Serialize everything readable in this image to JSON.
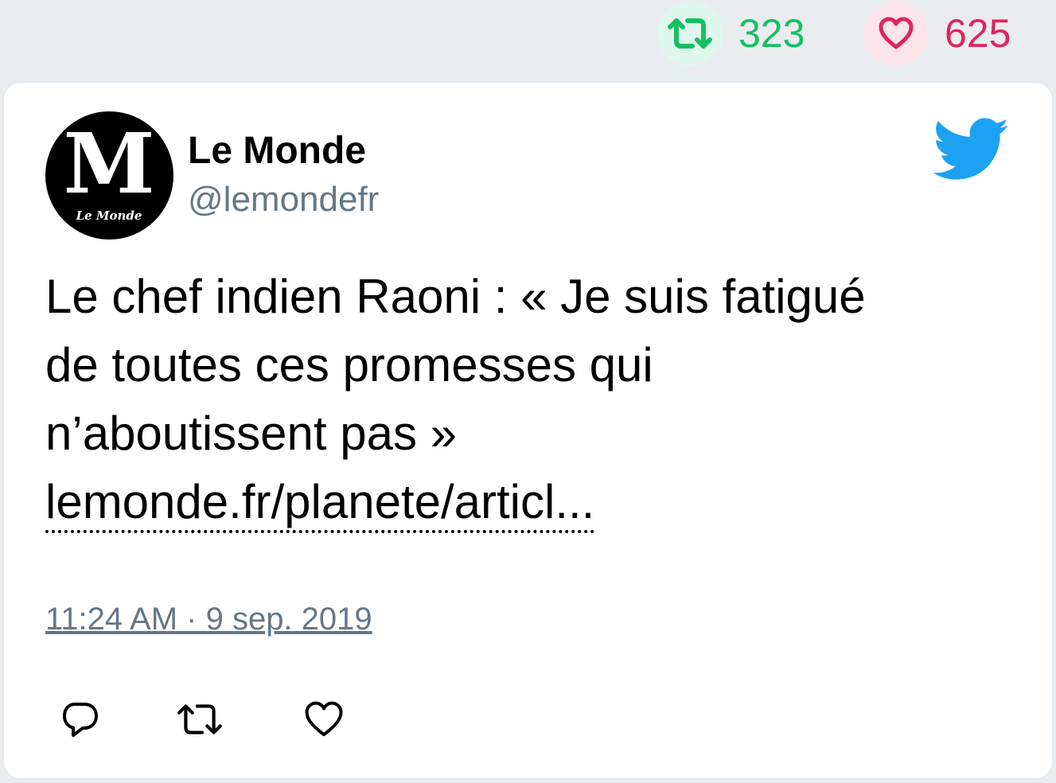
{
  "stats": {
    "retweet_count": "323",
    "like_count": "625",
    "retweet_icon": "retweet-icon",
    "like_icon": "heart-icon",
    "retweet_color": "#17bf63",
    "like_color": "#e0245e"
  },
  "tweet": {
    "author_name": "Le Monde",
    "author_handle": "@lemondefr",
    "avatar_letter": "M",
    "avatar_caption": "Le Monde",
    "text_lines": [
      "Le chef indien Raoni : « Je suis fatigué",
      "de toutes ces promesses qui",
      "n’aboutissent pas »"
    ],
    "link_text": "lemonde.fr/planete/articl...",
    "timestamp": "11:24 AM · 9 sep. 2019",
    "brand_icon": "twitter-bird-icon",
    "brand_color": "#1da1f2"
  },
  "actions": {
    "reply_icon": "reply-icon",
    "retweet_icon": "retweet-icon",
    "like_icon": "heart-icon"
  }
}
